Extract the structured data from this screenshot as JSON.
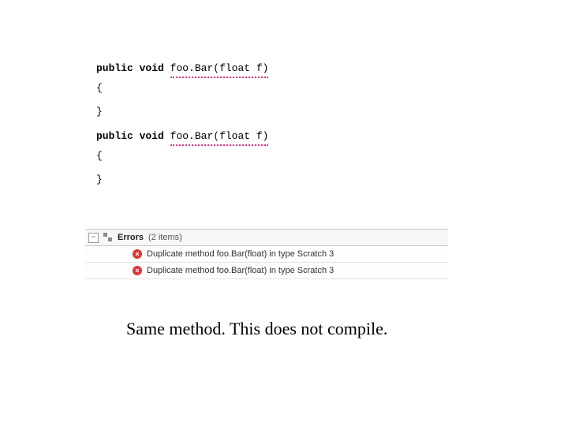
{
  "code": {
    "kw_public": "public",
    "kw_void": "void",
    "sig1": "foo.Bar(float f)",
    "sig2": "foo.Bar(float f)",
    "brace_open": "{",
    "brace_close": "}"
  },
  "errors_panel": {
    "toggle_glyph": "−",
    "header_label": "Errors",
    "header_count": "(2 items)",
    "items": [
      {
        "message": "Duplicate method foo.Bar(float) in type Scratch 3"
      },
      {
        "message": "Duplicate method foo.Bar(float) in type Scratch 3"
      }
    ]
  },
  "caption": "Same method.  This does not compile."
}
